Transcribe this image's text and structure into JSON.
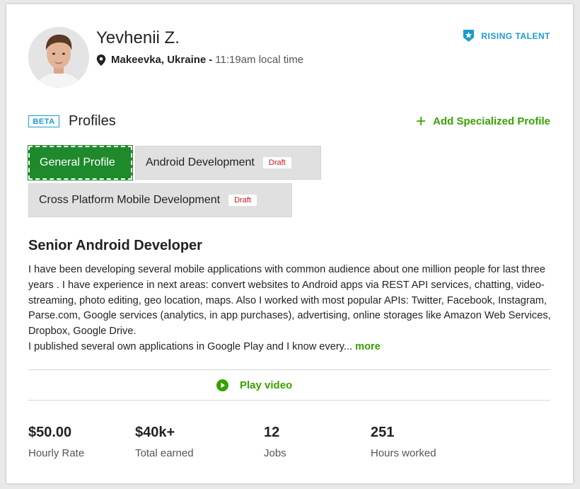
{
  "profile": {
    "name": "Yevhenii Z.",
    "city": "Makeevka, Ukraine",
    "separator": "-",
    "local_time": "11:19am local time",
    "badge": "RISING TALENT"
  },
  "profiles": {
    "beta_label": "BETA",
    "title": "Profiles",
    "add_label": "Add Specialized Profile",
    "tabs": [
      {
        "label": "General Profile",
        "draft": ""
      },
      {
        "label": "Android Development",
        "draft": "Draft"
      },
      {
        "label": "Cross Platform Mobile Development",
        "draft": "Draft"
      }
    ]
  },
  "overview": {
    "title": "Senior Android Developer",
    "description": "I have been developing several mobile applications with common audience about one million people for last three years . I have experience in next areas: convert websites to Android apps via REST API services, chatting, video-streaming, photo editing, geo location, maps. Also I worked with most popular APIs: Twitter, Facebook, Instagram, Parse.com, Google services (analytics, in app purchases), advertising, online storages like Amazon Web Services, Dropbox, Google Drive.",
    "description2": "I published several own applications in Google Play and I know every...",
    "more_label": "more",
    "play_label": "Play video"
  },
  "stats": [
    {
      "value": "$50.00",
      "label": "Hourly Rate"
    },
    {
      "value": "$40k+",
      "label": "Total earned"
    },
    {
      "value": "12",
      "label": "Jobs"
    },
    {
      "value": "251",
      "label": "Hours worked"
    }
  ],
  "colors": {
    "accent_green": "#37a000",
    "active_tab": "#1e8a2b",
    "blue": "#1a9bd1",
    "draft_red": "#c9161d"
  }
}
